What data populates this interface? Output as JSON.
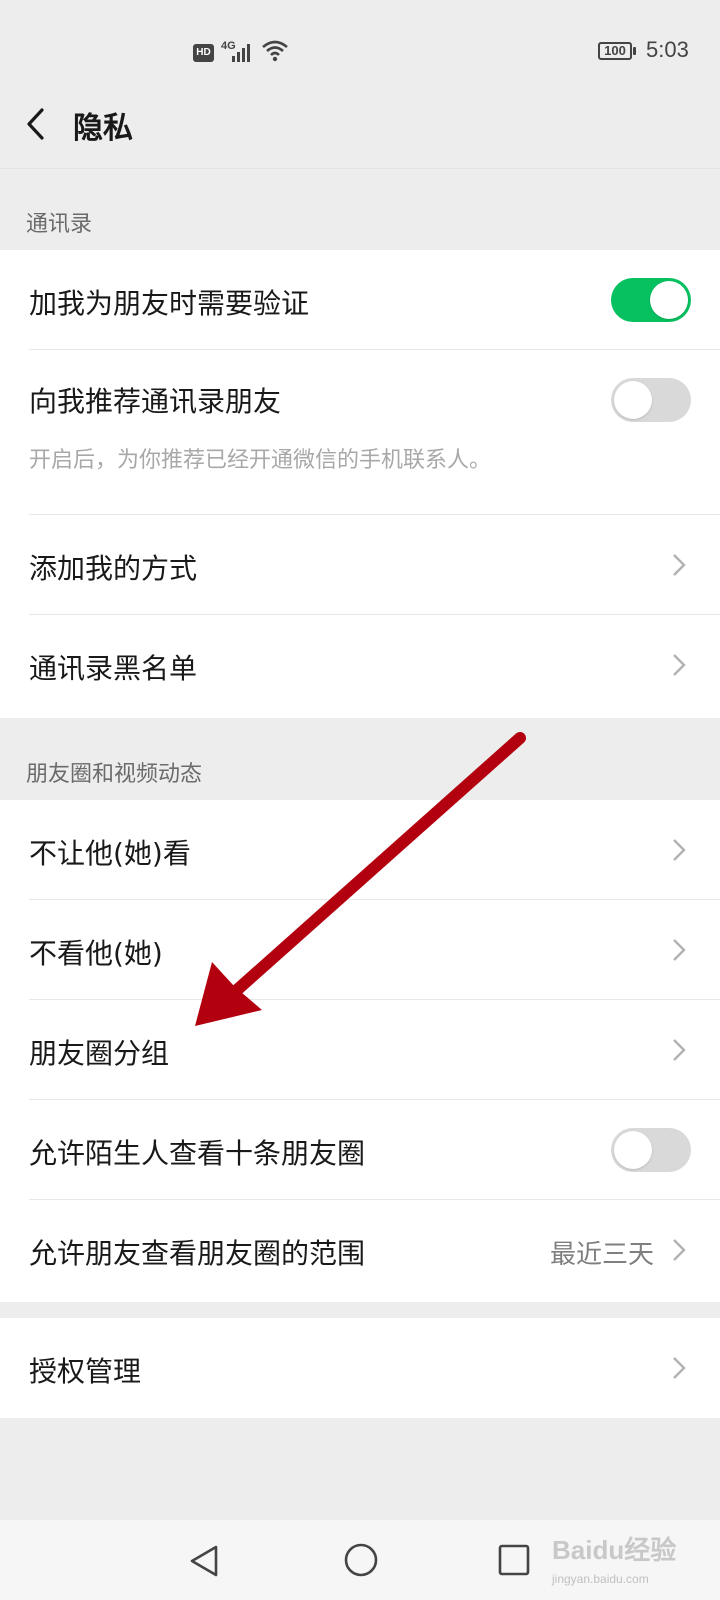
{
  "status_bar": {
    "hd": "HD",
    "network": "4G",
    "battery": "100",
    "time": "5:03"
  },
  "header": {
    "title": "隐私"
  },
  "sections": {
    "contacts": {
      "label": "通讯录",
      "rows": [
        {
          "label": "加我为朋友时需要验证",
          "toggle": "on"
        },
        {
          "label": "向我推荐通讯录朋友",
          "sub": "开启后，为你推荐已经开通微信的手机联系人。",
          "toggle": "off"
        },
        {
          "label": "添加我的方式"
        },
        {
          "label": "通讯录黑名单"
        }
      ]
    },
    "moments": {
      "label": "朋友圈和视频动态",
      "rows": [
        {
          "label": "不让他(她)看"
        },
        {
          "label": "不看他(她)"
        },
        {
          "label": "朋友圈分组"
        },
        {
          "label": "允许陌生人查看十条朋友圈",
          "toggle": "off"
        },
        {
          "label": "允许朋友查看朋友圈的范围",
          "value": "最近三天"
        }
      ]
    },
    "auth": {
      "rows": [
        {
          "label": "授权管理"
        }
      ]
    }
  },
  "watermark": {
    "text": "Baidu经验",
    "sub": "jingyan.baidu.com"
  },
  "colors": {
    "toggle_on": "#07c160",
    "annotation_arrow": "#b3000f"
  }
}
